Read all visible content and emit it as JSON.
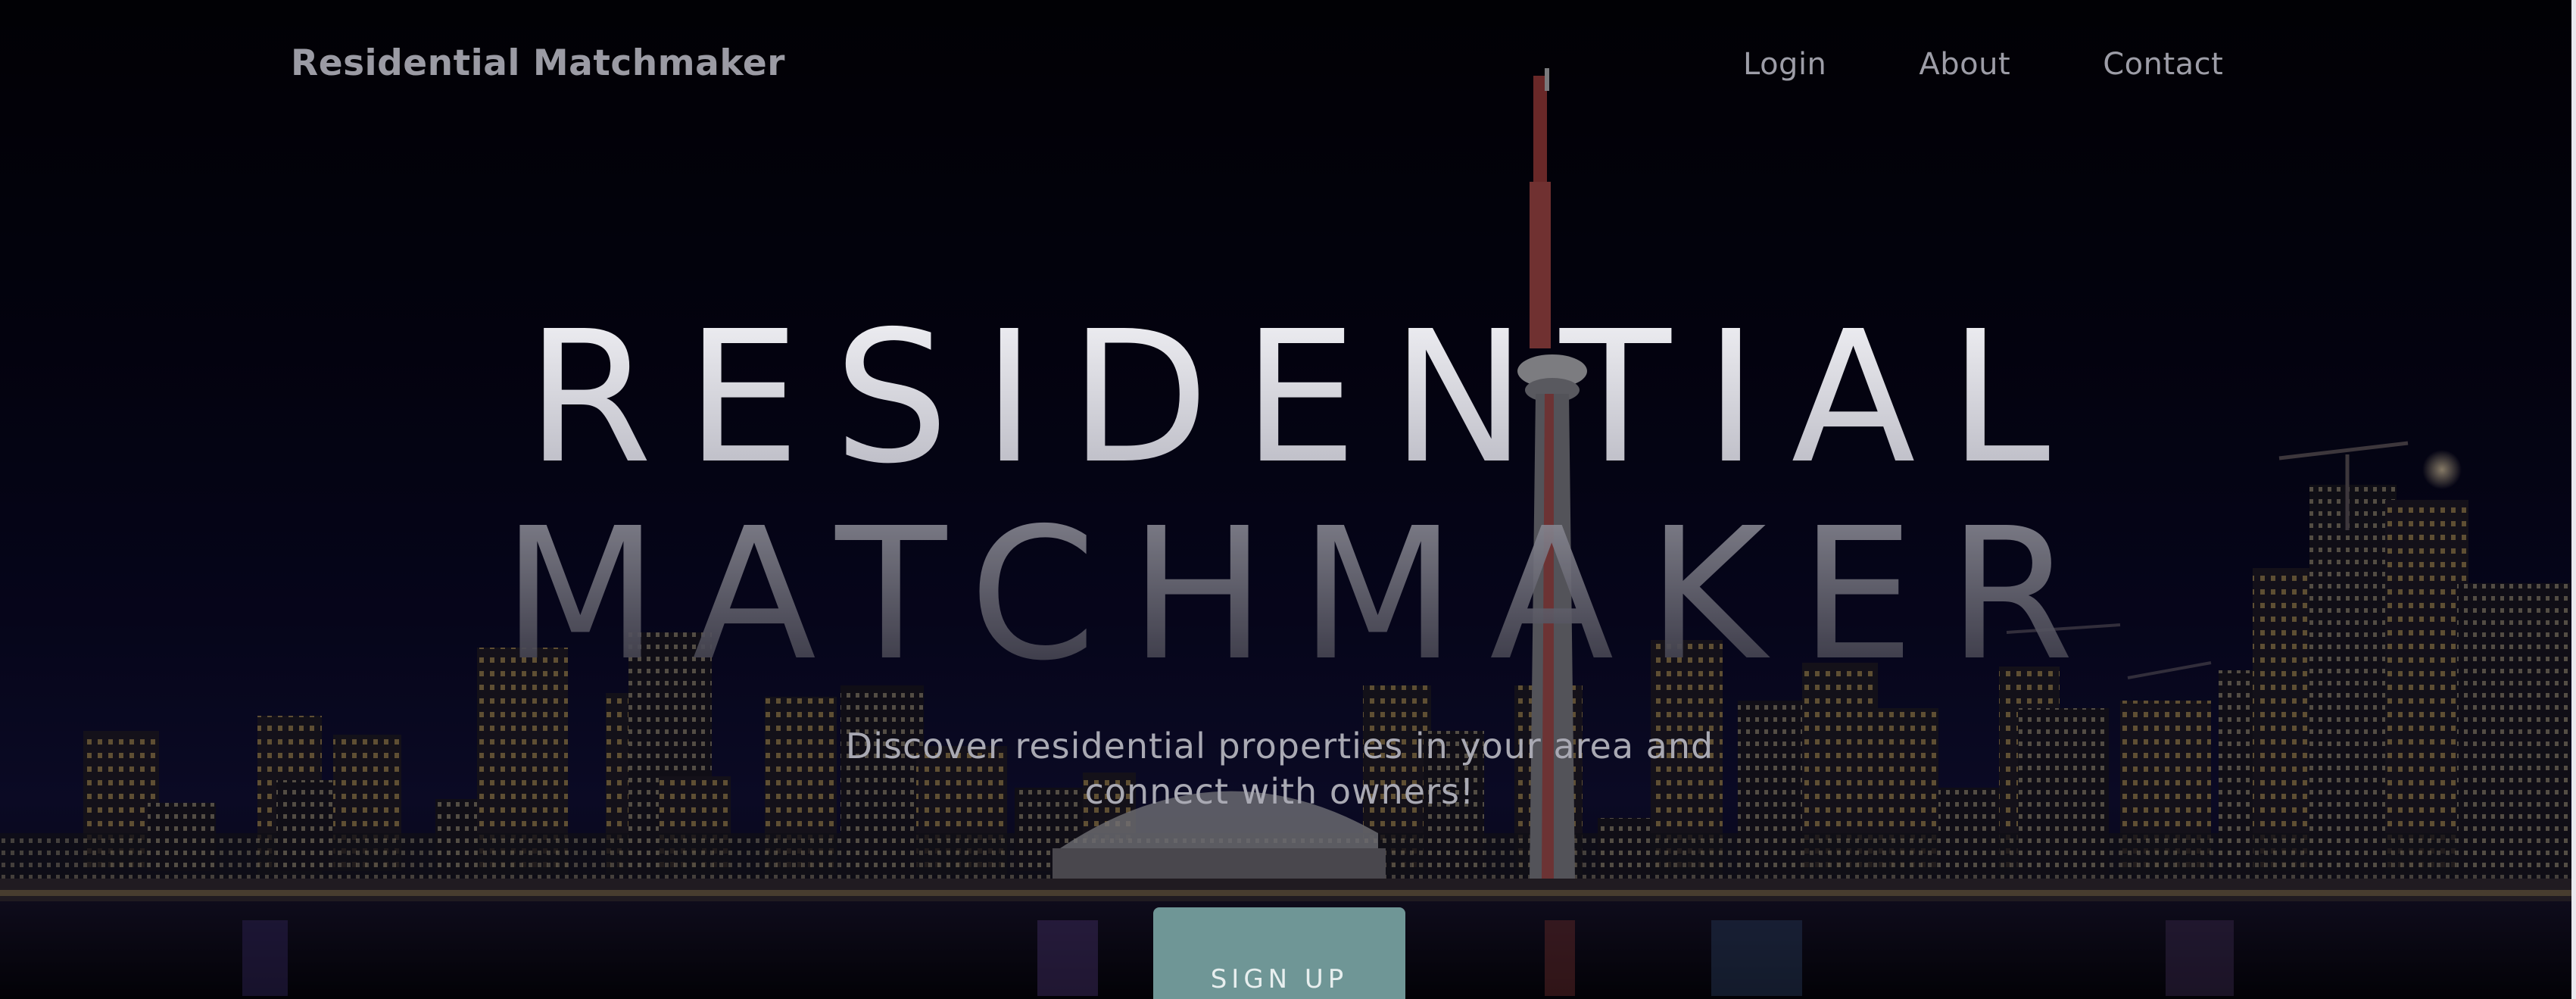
{
  "nav": {
    "brand": "Residential Matchmaker",
    "links": [
      {
        "label": "Login"
      },
      {
        "label": "About"
      },
      {
        "label": "Contact"
      }
    ]
  },
  "hero": {
    "title_line1": "RESIDENTIAL",
    "title_line2": "MATCHMAKER",
    "tagline": "Discover residential properties in your area and connect with owners!",
    "cta_label": "SIGN UP",
    "background": "night-city-skyline-image"
  },
  "colors": {
    "cta_background": "#6f9696",
    "nav_text": "#9d9da7",
    "page_background": "#04030b"
  }
}
